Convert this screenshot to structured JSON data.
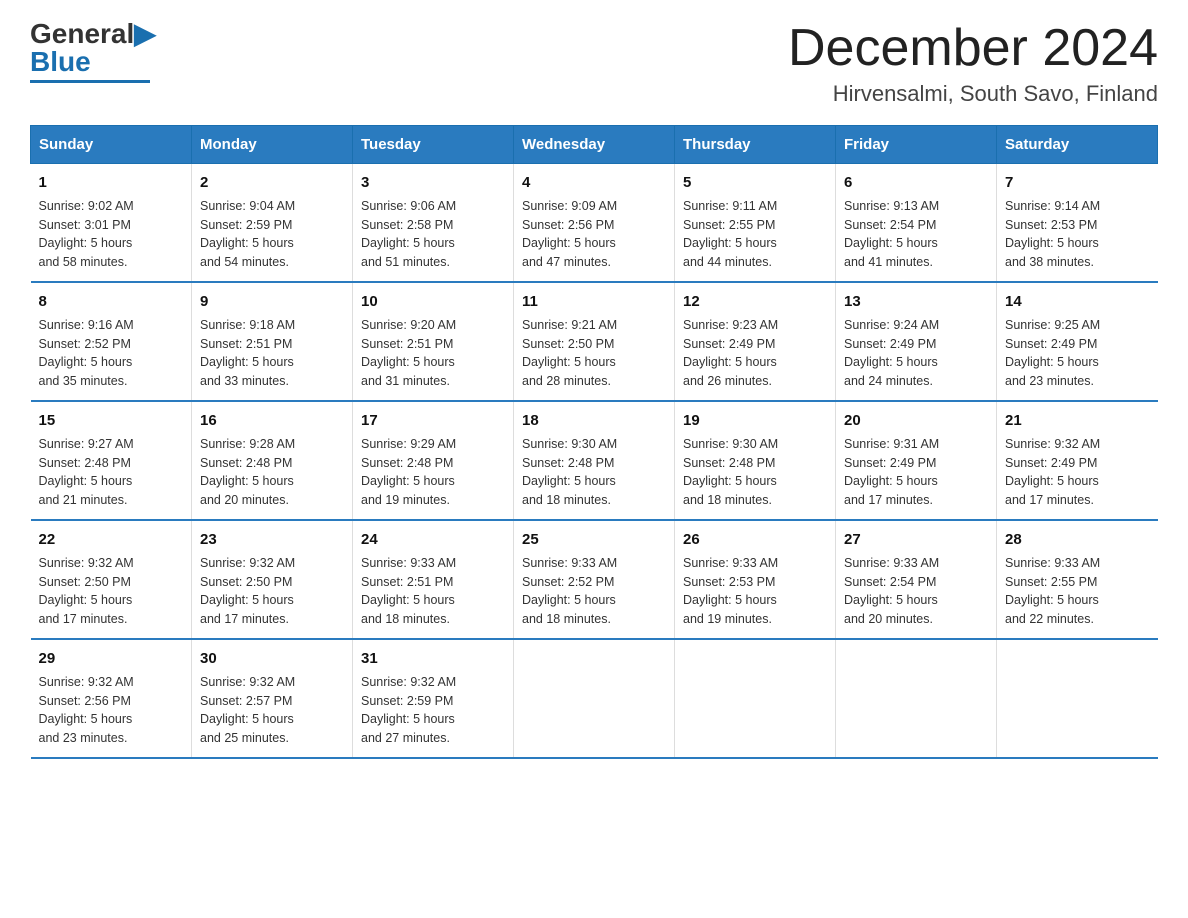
{
  "header": {
    "logo_general": "General",
    "logo_blue": "Blue",
    "month_title": "December 2024",
    "location": "Hirvensalmi, South Savo, Finland"
  },
  "days_of_week": [
    "Sunday",
    "Monday",
    "Tuesday",
    "Wednesday",
    "Thursday",
    "Friday",
    "Saturday"
  ],
  "weeks": [
    [
      {
        "num": "1",
        "sunrise": "9:02 AM",
        "sunset": "3:01 PM",
        "daylight": "5 hours and 58 minutes."
      },
      {
        "num": "2",
        "sunrise": "9:04 AM",
        "sunset": "2:59 PM",
        "daylight": "5 hours and 54 minutes."
      },
      {
        "num": "3",
        "sunrise": "9:06 AM",
        "sunset": "2:58 PM",
        "daylight": "5 hours and 51 minutes."
      },
      {
        "num": "4",
        "sunrise": "9:09 AM",
        "sunset": "2:56 PM",
        "daylight": "5 hours and 47 minutes."
      },
      {
        "num": "5",
        "sunrise": "9:11 AM",
        "sunset": "2:55 PM",
        "daylight": "5 hours and 44 minutes."
      },
      {
        "num": "6",
        "sunrise": "9:13 AM",
        "sunset": "2:54 PM",
        "daylight": "5 hours and 41 minutes."
      },
      {
        "num": "7",
        "sunrise": "9:14 AM",
        "sunset": "2:53 PM",
        "daylight": "5 hours and 38 minutes."
      }
    ],
    [
      {
        "num": "8",
        "sunrise": "9:16 AM",
        "sunset": "2:52 PM",
        "daylight": "5 hours and 35 minutes."
      },
      {
        "num": "9",
        "sunrise": "9:18 AM",
        "sunset": "2:51 PM",
        "daylight": "5 hours and 33 minutes."
      },
      {
        "num": "10",
        "sunrise": "9:20 AM",
        "sunset": "2:51 PM",
        "daylight": "5 hours and 31 minutes."
      },
      {
        "num": "11",
        "sunrise": "9:21 AM",
        "sunset": "2:50 PM",
        "daylight": "5 hours and 28 minutes."
      },
      {
        "num": "12",
        "sunrise": "9:23 AM",
        "sunset": "2:49 PM",
        "daylight": "5 hours and 26 minutes."
      },
      {
        "num": "13",
        "sunrise": "9:24 AM",
        "sunset": "2:49 PM",
        "daylight": "5 hours and 24 minutes."
      },
      {
        "num": "14",
        "sunrise": "9:25 AM",
        "sunset": "2:49 PM",
        "daylight": "5 hours and 23 minutes."
      }
    ],
    [
      {
        "num": "15",
        "sunrise": "9:27 AM",
        "sunset": "2:48 PM",
        "daylight": "5 hours and 21 minutes."
      },
      {
        "num": "16",
        "sunrise": "9:28 AM",
        "sunset": "2:48 PM",
        "daylight": "5 hours and 20 minutes."
      },
      {
        "num": "17",
        "sunrise": "9:29 AM",
        "sunset": "2:48 PM",
        "daylight": "5 hours and 19 minutes."
      },
      {
        "num": "18",
        "sunrise": "9:30 AM",
        "sunset": "2:48 PM",
        "daylight": "5 hours and 18 minutes."
      },
      {
        "num": "19",
        "sunrise": "9:30 AM",
        "sunset": "2:48 PM",
        "daylight": "5 hours and 18 minutes."
      },
      {
        "num": "20",
        "sunrise": "9:31 AM",
        "sunset": "2:49 PM",
        "daylight": "5 hours and 17 minutes."
      },
      {
        "num": "21",
        "sunrise": "9:32 AM",
        "sunset": "2:49 PM",
        "daylight": "5 hours and 17 minutes."
      }
    ],
    [
      {
        "num": "22",
        "sunrise": "9:32 AM",
        "sunset": "2:50 PM",
        "daylight": "5 hours and 17 minutes."
      },
      {
        "num": "23",
        "sunrise": "9:32 AM",
        "sunset": "2:50 PM",
        "daylight": "5 hours and 17 minutes."
      },
      {
        "num": "24",
        "sunrise": "9:33 AM",
        "sunset": "2:51 PM",
        "daylight": "5 hours and 18 minutes."
      },
      {
        "num": "25",
        "sunrise": "9:33 AM",
        "sunset": "2:52 PM",
        "daylight": "5 hours and 18 minutes."
      },
      {
        "num": "26",
        "sunrise": "9:33 AM",
        "sunset": "2:53 PM",
        "daylight": "5 hours and 19 minutes."
      },
      {
        "num": "27",
        "sunrise": "9:33 AM",
        "sunset": "2:54 PM",
        "daylight": "5 hours and 20 minutes."
      },
      {
        "num": "28",
        "sunrise": "9:33 AM",
        "sunset": "2:55 PM",
        "daylight": "5 hours and 22 minutes."
      }
    ],
    [
      {
        "num": "29",
        "sunrise": "9:32 AM",
        "sunset": "2:56 PM",
        "daylight": "5 hours and 23 minutes."
      },
      {
        "num": "30",
        "sunrise": "9:32 AM",
        "sunset": "2:57 PM",
        "daylight": "5 hours and 25 minutes."
      },
      {
        "num": "31",
        "sunrise": "9:32 AM",
        "sunset": "2:59 PM",
        "daylight": "5 hours and 27 minutes."
      },
      null,
      null,
      null,
      null
    ]
  ],
  "labels": {
    "sunrise": "Sunrise:",
    "sunset": "Sunset:",
    "daylight": "Daylight:"
  }
}
